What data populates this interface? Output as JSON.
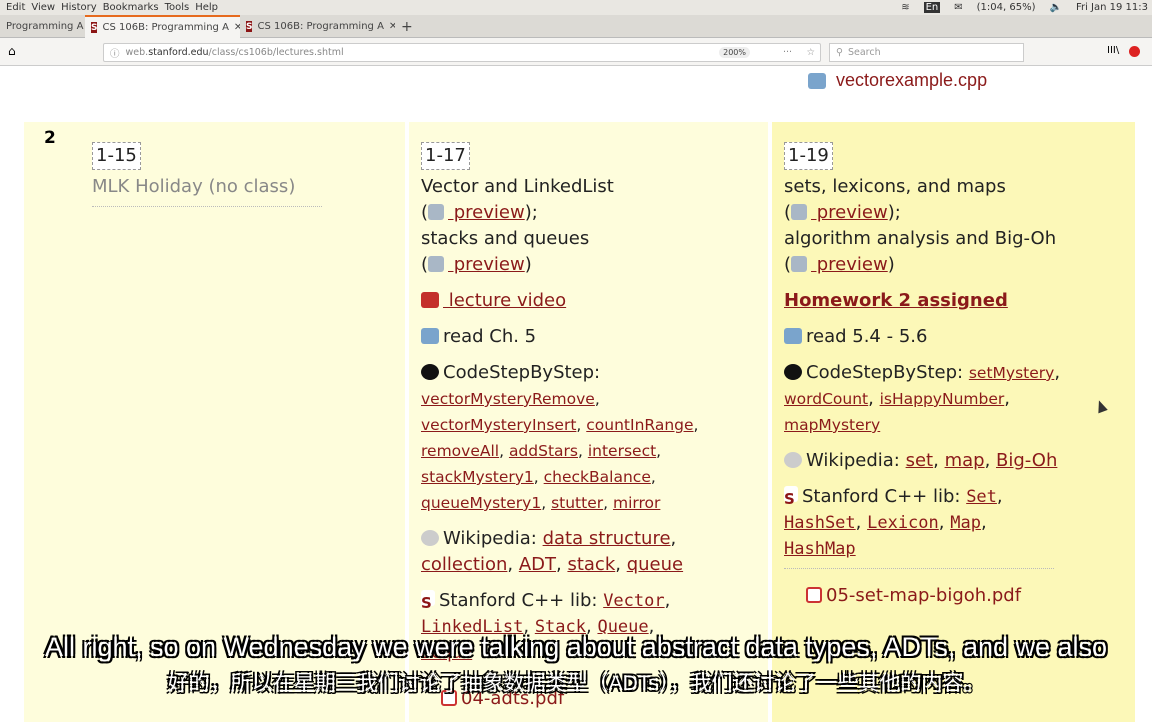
{
  "menubar": {
    "items": [
      "Edit",
      "View",
      "History",
      "Bookmarks",
      "Tools",
      "Help"
    ],
    "tray": {
      "battery": "(1:04, 65%)",
      "keyboard": "En",
      "datetime": "Fri Jan 19  11:3"
    }
  },
  "tabs": [
    {
      "title": "Programming A"
    },
    {
      "title": "CS 106B: Programming A",
      "active": true
    },
    {
      "title": "CS 106B: Programming A"
    }
  ],
  "new_tab": "+",
  "address": {
    "prefix": "web.",
    "domain": "stanford.edu",
    "path": "/class/cs106b/lectures.shtml",
    "zoom": "200%"
  },
  "search": {
    "placeholder": "Search"
  },
  "page": {
    "top_file": "vectorexample.cpp",
    "week": "2",
    "col1": {
      "date": "1-15",
      "title": "MLK Holiday (no class)"
    },
    "col2": {
      "date": "1-17",
      "topic1": "Vector and LinkedList",
      "preview": " preview",
      "topic2": "stacks and queues",
      "video": " lecture video",
      "read": "read Ch. 5",
      "csbs_label": "CodeStepByStep:",
      "csbs_links": [
        "vectorMysteryRemove",
        "vectorMysteryInsert",
        "countInRange",
        "removeAll",
        "addStars",
        "intersect",
        "stackMystery1",
        "checkBalance",
        "queueMystery1",
        "stutter",
        "mirror"
      ],
      "wiki_label": "Wikipedia:",
      "wiki_links": [
        "data structure",
        "collection",
        "ADT",
        "stack",
        "queue"
      ],
      "lib_label": "Stanford C++ lib:",
      "lib_links": [
        "Vector",
        "LinkedList",
        "Stack",
        "Queue",
        "Deque"
      ],
      "file": "04-adts.pdf"
    },
    "col3": {
      "date": "1-19",
      "topic1": "sets, lexicons, and maps",
      "preview": " preview",
      "topic2": "algorithm analysis and Big-Oh",
      "homework": "Homework 2 assigned",
      "read": "read 5.4 - 5.6",
      "csbs_label": "CodeStepByStep:",
      "csbs_links": [
        "setMystery",
        "wordCount",
        "isHappyNumber",
        "mapMystery"
      ],
      "wiki_label": "Wikipedia:",
      "wiki_links": [
        "set",
        "map",
        "Big-Oh"
      ],
      "lib_label": "Stanford C++ lib:",
      "lib_links": [
        "Set",
        "HashSet",
        "Lexicon",
        "Map",
        "HashMap"
      ],
      "file": "05-set-map-bigoh.pdf"
    }
  },
  "subtitles": {
    "en": "All right, so on Wednesday we were talking about abstract data types, ADTs, and we also",
    "zh": "好的，所以在星期三我们讨论了抽象数据类型（ADTs），我们还讨论了一些其他的内容。"
  }
}
